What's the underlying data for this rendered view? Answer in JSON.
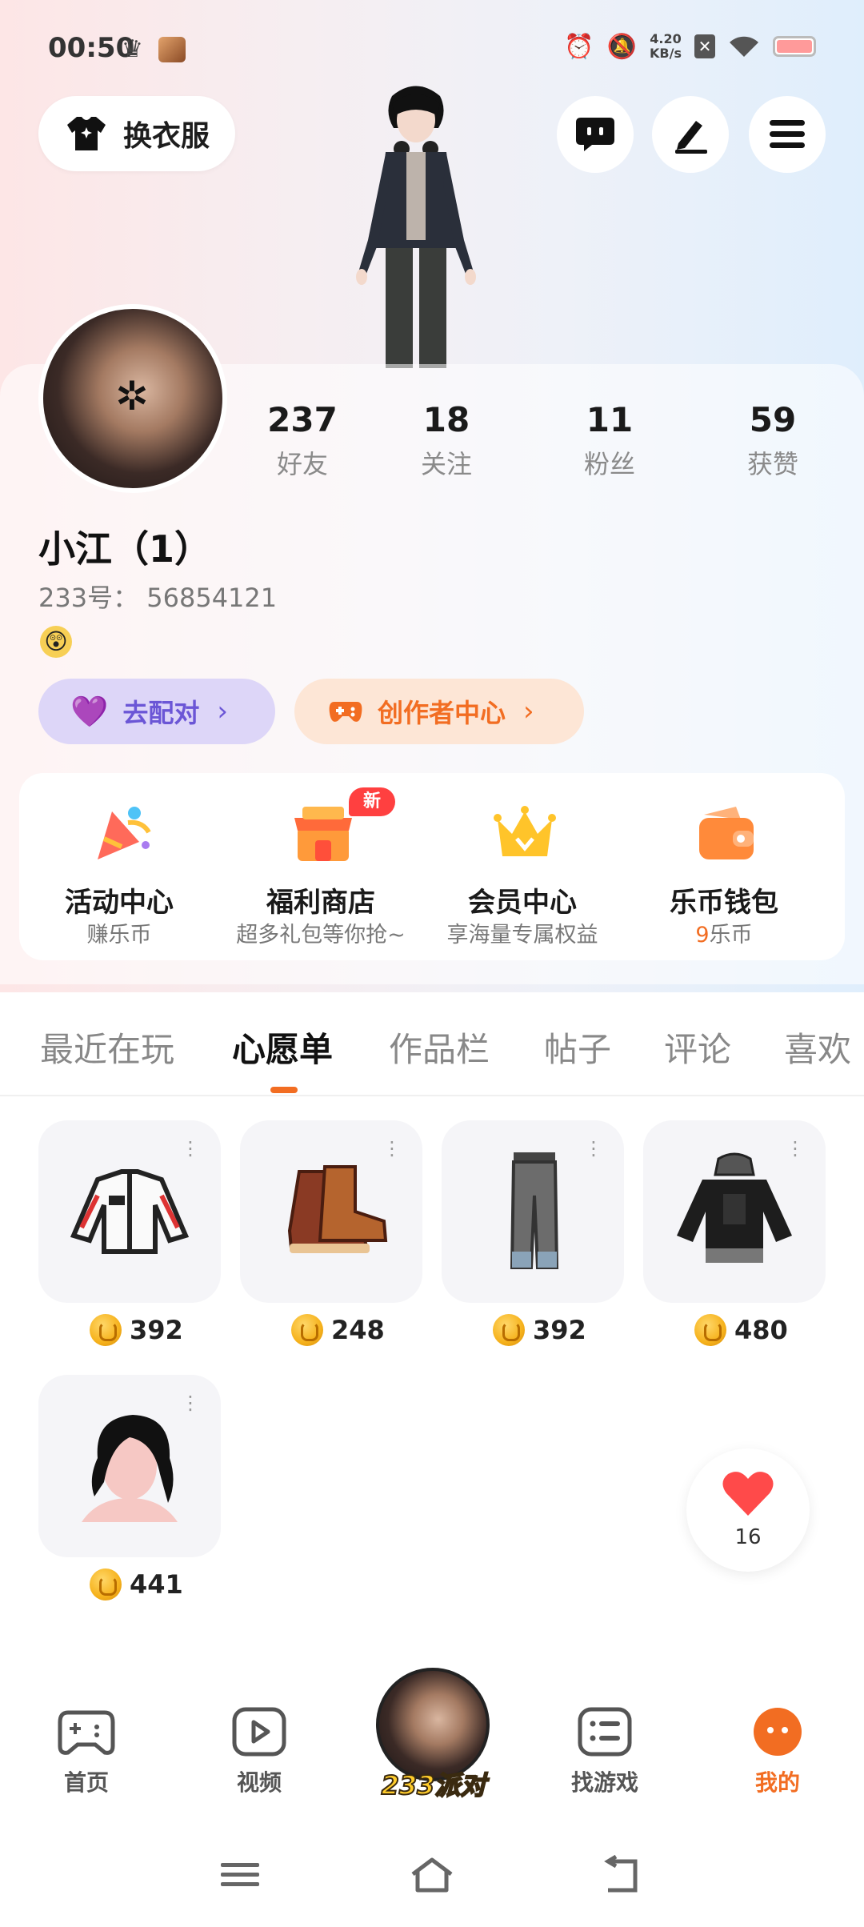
{
  "status_bar": {
    "time": "00:50",
    "net_speed_value": "4.20",
    "net_speed_unit": "KB/s",
    "sim_icon": "✕"
  },
  "header": {
    "outfit_label": "换衣服"
  },
  "profile": {
    "stats": [
      {
        "num": "237",
        "label": "好友"
      },
      {
        "num": "18",
        "label": "关注"
      },
      {
        "num": "11",
        "label": "粉丝"
      },
      {
        "num": "59",
        "label": "获赞"
      }
    ],
    "username": "小江（1）",
    "user_id": "233号： 56854121",
    "mood_emoji": "😲",
    "match_label": "去配对",
    "creator_label": "创作者中心",
    "chevron": "›"
  },
  "quick_menu": [
    {
      "title": "活动中心",
      "sub": "赚乐币"
    },
    {
      "title": "福利商店",
      "sub": "超多礼包等你抢~",
      "badge": "新"
    },
    {
      "title": "会员中心",
      "sub": "享海量专属权益"
    },
    {
      "title": "乐币钱包",
      "sub_highlight": "9",
      "sub": "乐币"
    }
  ],
  "tabs": [
    "最近在玩",
    "心愿单",
    "作品栏",
    "帖子",
    "评论",
    "喜欢"
  ],
  "active_tab": "心愿单",
  "wishlist": [
    {
      "item": "jacket",
      "price": "392"
    },
    {
      "item": "boots",
      "price": "248"
    },
    {
      "item": "jeans",
      "price": "392"
    },
    {
      "item": "hoodie",
      "price": "480"
    },
    {
      "item": "hair",
      "price": "441"
    }
  ],
  "like": {
    "count": "16"
  },
  "bottom_nav": {
    "home": "首页",
    "video": "视频",
    "center": "233派对",
    "find_games": "找游戏",
    "mine": "我的"
  },
  "colors": {
    "accent": "#f26d22",
    "match_purple": "#6b56d6",
    "badge_red": "#ff4040"
  }
}
